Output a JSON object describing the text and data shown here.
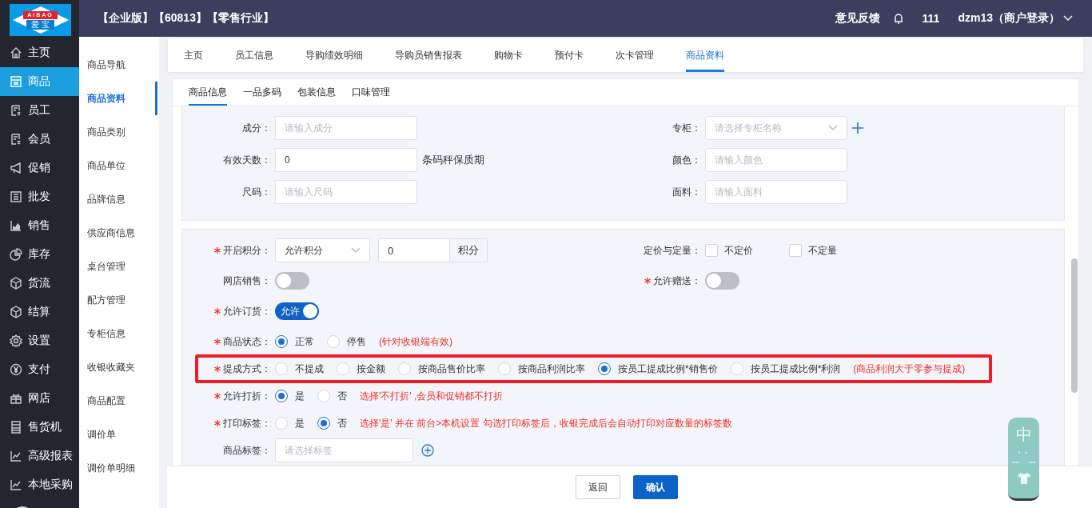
{
  "logo": {
    "top": "AIBAO",
    "bottom": "爱 宝"
  },
  "header": {
    "title": "【企业版】【60813】【零售行业】",
    "feedback": "意见反馈",
    "count": "111",
    "user": "dzm13（商户登录）"
  },
  "nav": [
    {
      "label": "主页",
      "selected": false
    },
    {
      "label": "商品",
      "selected": true
    },
    {
      "label": "员工",
      "selected": false
    },
    {
      "label": "会员",
      "selected": false
    },
    {
      "label": "促销",
      "selected": false
    },
    {
      "label": "批发",
      "selected": false
    },
    {
      "label": "销售",
      "selected": false
    },
    {
      "label": "库存",
      "selected": false
    },
    {
      "label": "货流",
      "selected": false
    },
    {
      "label": "结算",
      "selected": false
    },
    {
      "label": "设置",
      "selected": false
    },
    {
      "label": "支付",
      "selected": false
    },
    {
      "label": "网店",
      "selected": false
    },
    {
      "label": "售货机",
      "selected": false
    },
    {
      "label": "高级报表",
      "selected": false
    },
    {
      "label": "本地采购",
      "selected": false
    }
  ],
  "subnav": [
    {
      "label": "商品导航",
      "selected": false
    },
    {
      "label": "商品资料",
      "selected": true
    },
    {
      "label": "商品类别",
      "selected": false
    },
    {
      "label": "商品单位",
      "selected": false
    },
    {
      "label": "品牌信息",
      "selected": false
    },
    {
      "label": "供应商信息",
      "selected": false
    },
    {
      "label": "桌台管理",
      "selected": false
    },
    {
      "label": "配方管理",
      "selected": false
    },
    {
      "label": "专柜信息",
      "selected": false
    },
    {
      "label": "收银收藏夹",
      "selected": false
    },
    {
      "label": "商品配置",
      "selected": false
    },
    {
      "label": "调价单",
      "selected": false
    },
    {
      "label": "调价单明细",
      "selected": false
    }
  ],
  "tabs": [
    {
      "label": "主页",
      "selected": false
    },
    {
      "label": "员工信息",
      "selected": false
    },
    {
      "label": "导购绩效明细",
      "selected": false
    },
    {
      "label": "导购员销售报表",
      "selected": false
    },
    {
      "label": "购物卡",
      "selected": false
    },
    {
      "label": "预付卡",
      "selected": false
    },
    {
      "label": "次卡管理",
      "selected": false
    },
    {
      "label": "商品资料",
      "selected": true
    }
  ],
  "subtabs": [
    {
      "label": "商品信息",
      "selected": true
    },
    {
      "label": "一品多码",
      "selected": false
    },
    {
      "label": "包装信息",
      "selected": false
    },
    {
      "label": "口味管理",
      "selected": false
    }
  ],
  "section1": [
    {
      "left": {
        "label": "成分：",
        "kind": "input",
        "placeholder": "请输入成分"
      },
      "right": {
        "label": "专柜：",
        "kind": "select",
        "placeholder": "请选择专柜名称",
        "add": true
      }
    },
    {
      "left": {
        "label": "有效天数：",
        "kind": "input",
        "value": "0",
        "suffix": "条码秤保质期"
      },
      "right": {
        "label": "颜色：",
        "kind": "input",
        "placeholder": "请输入颜色"
      }
    },
    {
      "left": {
        "label": "尺码：",
        "kind": "input",
        "placeholder": "请输入尺码"
      },
      "right": {
        "label": "面料：",
        "kind": "input",
        "placeholder": "请输入面料"
      }
    }
  ],
  "section2": [
    {
      "left": {
        "label": "开启积分：",
        "required": true,
        "kind": "points",
        "select": "允许积分",
        "value": "0",
        "addon": "积分"
      },
      "right": {
        "label": "定价与定量：",
        "kind": "checkboxes",
        "options": [
          {
            "label": "不定价",
            "checked": false
          },
          {
            "label": "不定量",
            "checked": false
          }
        ]
      }
    },
    {
      "left": {
        "label": "网店销售：",
        "kind": "switch",
        "on": false
      },
      "right": {
        "label": "允许赠送：",
        "required": true,
        "kind": "switch",
        "on": false
      }
    },
    {
      "left": {
        "label": "允许订货：",
        "required": true,
        "kind": "switch",
        "on": true,
        "text": "允许"
      }
    },
    {
      "left": {
        "label": "商品状态：",
        "required": true,
        "kind": "radios",
        "options": [
          {
            "label": "正常",
            "selected": true
          },
          {
            "label": "停售",
            "selected": false
          }
        ],
        "note": "(针对收银端有效)"
      }
    },
    {
      "highlighted": true,
      "left": {
        "label": "提成方式：",
        "required": true,
        "kind": "radios",
        "options": [
          {
            "label": "不提成",
            "selected": false
          },
          {
            "label": "按金额",
            "selected": false
          },
          {
            "label": "按商品售价比率",
            "selected": false
          },
          {
            "label": "按商品利润比率",
            "selected": false
          },
          {
            "label": "按员工提成比例*销售价",
            "selected": true
          },
          {
            "label": "按员工提成比例*利润",
            "selected": false
          }
        ],
        "note": "(商品利润大于零参与提成)"
      }
    },
    {
      "left": {
        "label": "允许打折：",
        "required": true,
        "kind": "radios",
        "options": [
          {
            "label": "是",
            "selected": true
          },
          {
            "label": "否",
            "selected": false
          }
        ],
        "note": "选择'不打折' ,会员和促销都不打折"
      }
    },
    {
      "left": {
        "label": "打印标签：",
        "required": true,
        "kind": "radios",
        "options": [
          {
            "label": "是",
            "selected": false
          },
          {
            "label": "否",
            "selected": true
          }
        ],
        "note": "选择'是' 并在 前台>本机设置 勾选打印标签后，收银完成后会自动打印对应数量的标签数"
      }
    },
    {
      "left": {
        "label": "商品标签：",
        "kind": "tags",
        "placeholder": "请选择标签"
      }
    }
  ],
  "footer": [
    {
      "label": "返回",
      "kind": "default"
    },
    {
      "label": "确认",
      "kind": "primary"
    }
  ],
  "ime": {
    "mode": "中",
    "punct": "，。"
  }
}
